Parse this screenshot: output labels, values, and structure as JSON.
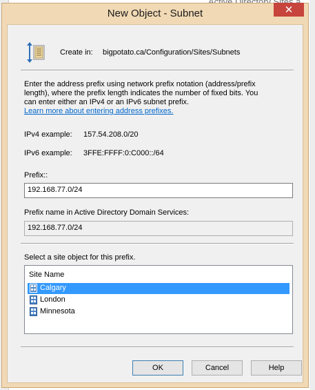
{
  "background": {
    "title_fragment": "Active Directory Sites a"
  },
  "dialog": {
    "title": "New Object - Subnet",
    "close_glyph": "✕"
  },
  "create_in": {
    "label": "Create in:",
    "path": "bigpotato.ca/Configuration/Sites/Subnets"
  },
  "description": {
    "text": "Enter the address prefix using network prefix notation (address/prefix length), where the prefix length indicates the number of fixed bits. You can enter either an IPv4 or an IPv6 subnet prefix.",
    "learn_more": "Learn more about entering address prefixes."
  },
  "examples": {
    "ipv4_label": "IPv4 example:",
    "ipv4_value": "157.54.208.0/20",
    "ipv6_label": "IPv6 example:",
    "ipv6_value": "3FFE:FFFF:0:C000::/64"
  },
  "prefix": {
    "label": "Prefix::",
    "value": "192.168.77.0/24"
  },
  "prefix_name": {
    "label": "Prefix name in Active Directory Domain Services:",
    "value": "192.168.77.0/24"
  },
  "sites": {
    "label": "Select a site object for this prefix.",
    "column_header": "Site Name",
    "items": [
      {
        "name": "Calgary",
        "selected": true
      },
      {
        "name": "London",
        "selected": false
      },
      {
        "name": "Minnesota",
        "selected": false
      }
    ]
  },
  "buttons": {
    "ok": "OK",
    "cancel": "Cancel",
    "help": "Help"
  },
  "icons": {
    "create_in": "ad-container-icon",
    "site": "site-icon",
    "close": "close-icon"
  },
  "colors": {
    "title_bar": "#f1d9b5",
    "close_button": "#c7453c",
    "selection": "#3399ff",
    "link": "#0066cc"
  }
}
